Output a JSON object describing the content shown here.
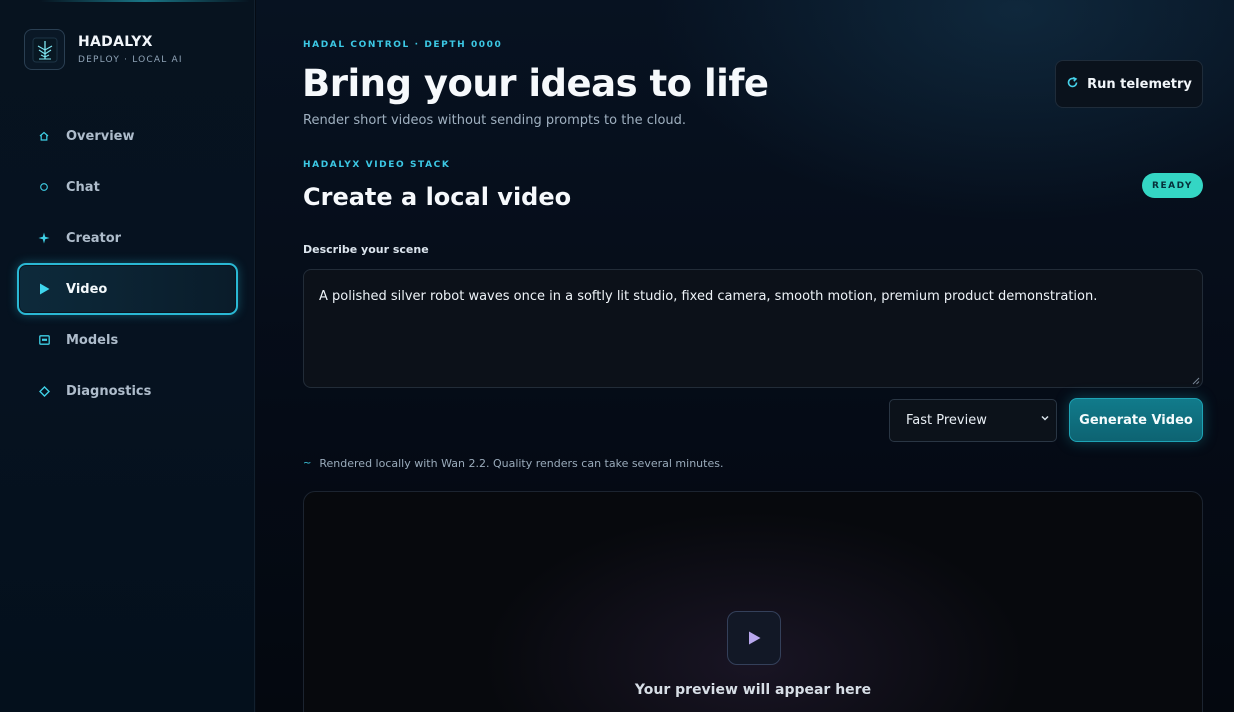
{
  "brand": {
    "name": "HADALYX",
    "tagline": "DEPLOY · LOCAL AI"
  },
  "nav": [
    {
      "label": "Overview",
      "icon": "home-icon",
      "active": false
    },
    {
      "label": "Chat",
      "icon": "circle-icon",
      "active": false
    },
    {
      "label": "Creator",
      "icon": "sparkle-icon",
      "active": false
    },
    {
      "label": "Video",
      "icon": "play-icon",
      "active": true
    },
    {
      "label": "Models",
      "icon": "box-icon",
      "active": false
    },
    {
      "label": "Diagnostics",
      "icon": "diamond-icon",
      "active": false
    }
  ],
  "header": {
    "kicker": "HADAL CONTROL · DEPTH 0000",
    "title": "Bring your ideas to life",
    "subtitle": "Render short videos without sending prompts to the cloud.",
    "telemetry_label": "Run telemetry"
  },
  "video": {
    "kicker": "HADALYX VIDEO STACK",
    "title": "Create a local video",
    "status": "READY",
    "prompt_label": "Describe your scene",
    "prompt_value": "A polished silver robot waves once in a softly lit studio, fixed camera, smooth motion, premium product demonstration.",
    "quality_selected": "Fast Preview",
    "generate_label": "Generate Video",
    "note": "Rendered locally with Wan 2.2. Quality renders can take several minutes.",
    "preview_placeholder": "Your preview will appear here"
  },
  "colors": {
    "accent": "#3cc8e4",
    "ready": "#34d6c4",
    "button": "#117b8b",
    "background": "#050b14"
  }
}
